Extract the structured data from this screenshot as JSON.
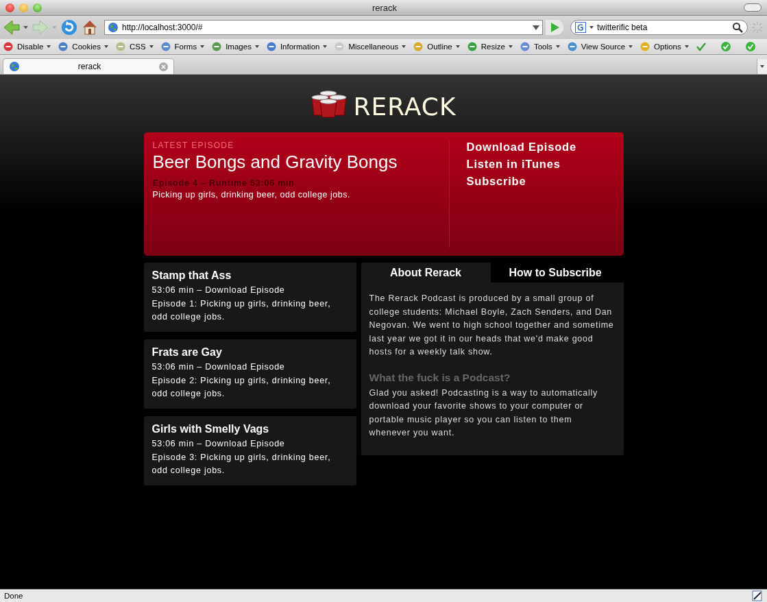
{
  "window": {
    "title": "rerack"
  },
  "nav": {
    "url": "http://localhost:3000/#",
    "search": "twitterific beta"
  },
  "toolbar": [
    {
      "label": "Disable"
    },
    {
      "label": "Cookies"
    },
    {
      "label": "CSS"
    },
    {
      "label": "Forms"
    },
    {
      "label": "Images"
    },
    {
      "label": "Information"
    },
    {
      "label": "Miscellaneous"
    },
    {
      "label": "Outline"
    },
    {
      "label": "Resize"
    },
    {
      "label": "Tools"
    },
    {
      "label": "View Source"
    },
    {
      "label": "Options"
    }
  ],
  "tabs": [
    {
      "label": "rerack",
      "selected": true
    }
  ],
  "page": {
    "logo": "RERACK",
    "hero": {
      "eyebrow": "LATEST EPISODE",
      "title": "Beer Bongs and Gravity Bongs",
      "meta": "Episode 4 – Runtime 53:06 min",
      "description": "Picking up girls, drinking beer, odd college jobs.",
      "links": [
        "Download Episode",
        "Listen in iTunes",
        "Subscribe"
      ]
    },
    "episodes": [
      {
        "title": "Stamp that Ass",
        "runtime": "53:06 min –",
        "link": "Download Episode",
        "description": "Episode 1: Picking up girls, drinking beer, odd college jobs."
      },
      {
        "title": "Frats are Gay",
        "runtime": "53:06 min –",
        "link": "Download Episode",
        "description": "Episode 2: Picking up girls, drinking beer, odd college jobs."
      },
      {
        "title": "Girls with Smelly Vags",
        "runtime": "53:06 min –",
        "link": "Download Episode",
        "description": "Episode 3: Picking up girls, drinking beer, odd college jobs."
      }
    ],
    "panel": {
      "tabs": [
        {
          "label": "About Rerack",
          "selected": true
        },
        {
          "label": "How to Subscribe",
          "selected": false
        }
      ],
      "intro": "The Rerack Podcast is produced by a small group of college students: Michael Boyle, Zach Senders, and Dan Negovan. We went to high school together and sometime last year we got it in our heads that we'd make good hosts for a weekly talk show.",
      "heading": "What the fuck is a Podcast?",
      "body": "Glad you asked! Podcasting is a way to automatically download your favorite shows to your computer or portable music player so you can listen to them whenever you want."
    }
  },
  "status_bar": {
    "text": "Done"
  }
}
